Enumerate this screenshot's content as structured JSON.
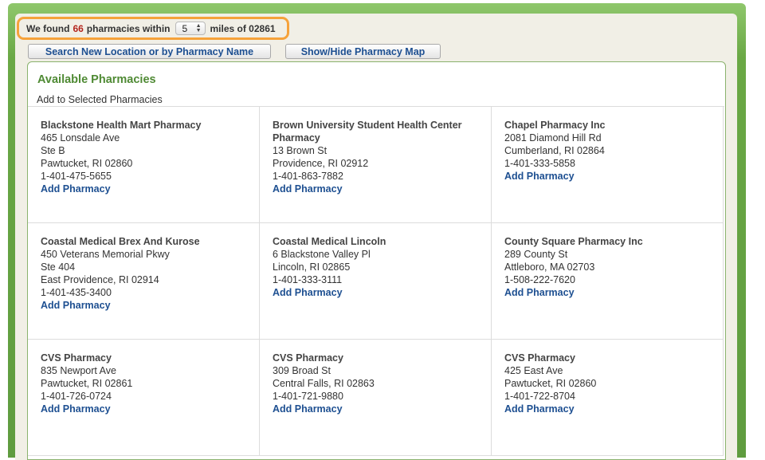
{
  "search": {
    "prefix": "We found",
    "count": "66",
    "middle": "pharmacies within",
    "miles_value": "5",
    "suffix": "miles of 02861"
  },
  "buttons": {
    "search_new": "Search New Location or by Pharmacy Name",
    "show_hide_map": "Show/Hide Pharmacy Map"
  },
  "results": {
    "title": "Available Pharmacies",
    "subtitle": "Add to Selected Pharmacies",
    "add_label": "Add Pharmacy",
    "pharmacies": [
      {
        "name": "Blackstone Health Mart Pharmacy",
        "lines": [
          "465 Lonsdale Ave",
          "Ste B",
          "Pawtucket, RI 02860",
          "1-401-475-5655"
        ]
      },
      {
        "name": "Brown University Student Health Center Pharmacy",
        "lines": [
          "13 Brown St",
          "Providence, RI 02912",
          "1-401-863-7882"
        ]
      },
      {
        "name": "Chapel Pharmacy Inc",
        "lines": [
          "2081 Diamond Hill Rd",
          "Cumberland, RI 02864",
          "1-401-333-5858"
        ]
      },
      {
        "name": "Coastal Medical Brex And Kurose",
        "lines": [
          "450 Veterans Memorial Pkwy",
          "Ste 404",
          "East Providence, RI 02914",
          "1-401-435-3400"
        ]
      },
      {
        "name": "Coastal Medical Lincoln",
        "lines": [
          "6 Blackstone Valley Pl",
          "Lincoln, RI 02865",
          "1-401-333-3111"
        ]
      },
      {
        "name": "County Square Pharmacy Inc",
        "lines": [
          "289 County St",
          "Attleboro, MA 02703",
          "1-508-222-7620"
        ]
      },
      {
        "name": "CVS Pharmacy",
        "lines": [
          "835 Newport Ave",
          "Pawtucket, RI 02861",
          "1-401-726-0724"
        ]
      },
      {
        "name": "CVS Pharmacy",
        "lines": [
          "309 Broad St",
          "Central Falls, RI 02863",
          "1-401-721-9880"
        ]
      },
      {
        "name": "CVS Pharmacy",
        "lines": [
          "425 East Ave",
          "Pawtucket, RI 02860",
          "1-401-722-8704"
        ]
      }
    ]
  },
  "colors": {
    "frame_green": "#6aa845",
    "highlight_orange": "#f6a23a",
    "count_red": "#b4261e",
    "link_blue": "#1d4f91",
    "heading_green": "#4f8a34"
  }
}
